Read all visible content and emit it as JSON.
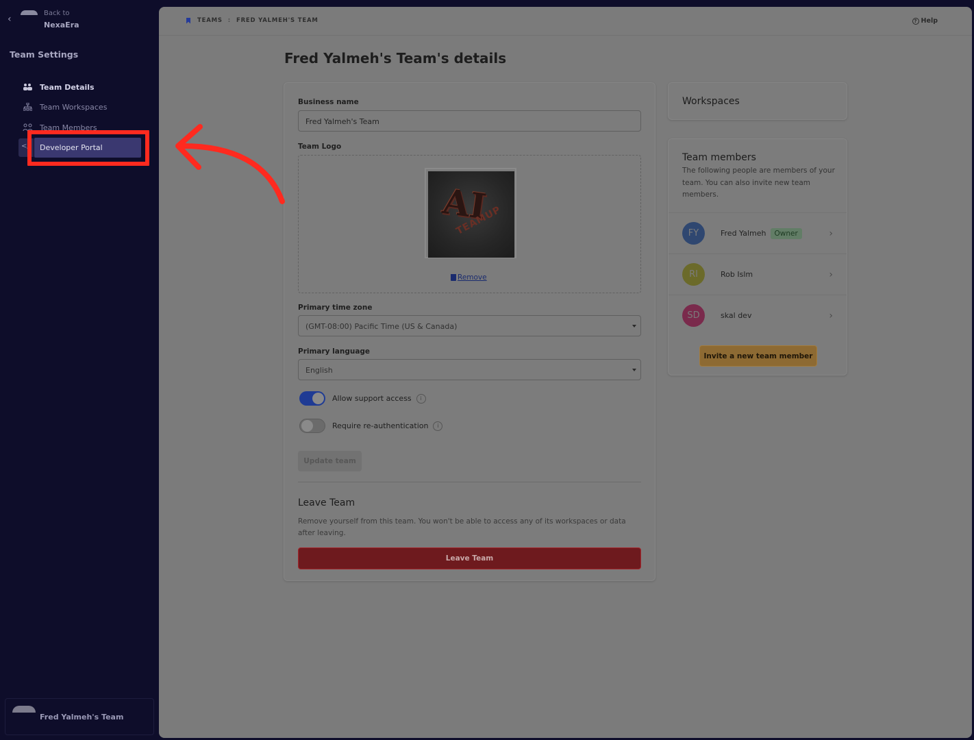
{
  "sidebar": {
    "back_to": "Back to",
    "back_app": "NexaEra",
    "title": "Team Settings",
    "items": [
      {
        "label": "Team Details"
      },
      {
        "label": "Team Workspaces"
      },
      {
        "label": "Team Members"
      },
      {
        "label": "Developer Portal"
      }
    ],
    "footer_team": "Fred Yalmeh's Team"
  },
  "header": {
    "crumbs": [
      "TEAMS",
      "FRED YALMEH'S TEAM"
    ],
    "help": "Help"
  },
  "page_title": "Fred Yalmeh's Team's details",
  "form": {
    "business_name_label": "Business name",
    "business_name_value": "Fred Yalmeh's Team",
    "team_logo_label": "Team Logo",
    "remove_label": "Remove",
    "timezone_label": "Primary time zone",
    "timezone_value": "(GMT-08:00) Pacific Time (US & Canada)",
    "language_label": "Primary language",
    "language_value": "English",
    "toggles": [
      {
        "label": "Allow support access",
        "on": true
      },
      {
        "label": "Require re-authentication",
        "on": false
      }
    ],
    "update_button": "Update team",
    "leave_title": "Leave Team",
    "leave_desc": "Remove yourself from this team. You won't be able to access any of its workspaces or data after leaving.",
    "leave_button": "Leave Team"
  },
  "workspaces": {
    "title": "Workspaces"
  },
  "members": {
    "title": "Team members",
    "desc": "The following people are members of your team. You can also invite new team members.",
    "list": [
      {
        "initials": "FY",
        "name": "Fred Yalmeh",
        "badge": "Owner",
        "color": "#2f4770"
      },
      {
        "initials": "RI",
        "name": "Rob Islm",
        "badge": "",
        "color": "#6b6a2a"
      },
      {
        "initials": "SD",
        "name": "skal dev",
        "badge": "",
        "color": "#7a2a4c"
      }
    ],
    "invite_button": "Invite a new team member"
  },
  "colors": {
    "highlight": "#ff2a1f",
    "sidebar_bg": "#0e0d2a",
    "active_nav": "#3a3870"
  }
}
